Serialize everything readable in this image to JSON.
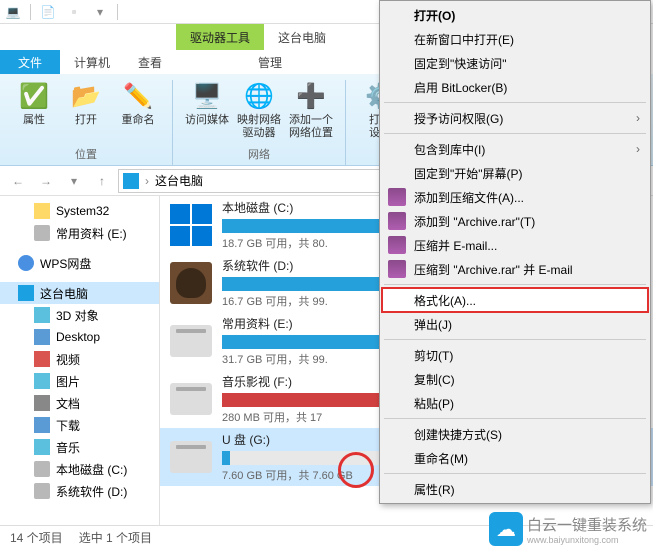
{
  "titlebar": {
    "drive_tools": "驱动器工具",
    "this_pc": "这台电脑"
  },
  "menu": {
    "file": "文件",
    "computer": "计算机",
    "view": "查看",
    "manage": "管理"
  },
  "ribbon": {
    "properties": "属性",
    "open": "打开",
    "rename": "重命名",
    "media": "访问媒体",
    "network": "映射网络\n驱动器",
    "netloc": "添加一个\n网络位置",
    "settings": "打开\n设置",
    "group_location": "位置",
    "group_network": "网络"
  },
  "address": {
    "path": "这台电脑"
  },
  "tree": {
    "system32": "System32",
    "common": "常用资料 (E:)",
    "wps": "WPS网盘",
    "thispc": "这台电脑",
    "obj3d": "3D 对象",
    "desktop": "Desktop",
    "video": "视频",
    "pictures": "图片",
    "docs": "文档",
    "downloads": "下载",
    "music": "音乐",
    "localc": "本地磁盘 (C:)",
    "sysd": "系统软件 (D:)"
  },
  "drives": [
    {
      "name": "本地磁盘 (C:)",
      "free": "18.7 GB 可用，共 80.",
      "pct": 76,
      "red": false,
      "icon": "win"
    },
    {
      "name": "系统软件 (D:)",
      "free": "16.7 GB 可用，共 99.",
      "pct": 82,
      "red": false,
      "icon": "avatar"
    },
    {
      "name": "常用资料 (E:)",
      "free": "31.7 GB 可用，共 99.",
      "pct": 66,
      "red": false,
      "icon": "drive"
    },
    {
      "name": "音乐影视 (F:)",
      "free": "280 MB 可用，共 17",
      "pct": 98,
      "red": true,
      "icon": "drive"
    },
    {
      "name": "U 盘 (G:)",
      "free": "7.60 GB 可用，共 7.60 GB",
      "pct": 2,
      "red": false,
      "icon": "drive",
      "sel": true
    }
  ],
  "ctx": {
    "open": "打开(O)",
    "newwin": "在新窗口中打开(E)",
    "pinquick": "固定到\"快速访问\"",
    "bitlocker": "启用 BitLocker(B)",
    "access": "授予访问权限(G)",
    "library": "包含到库中(I)",
    "pinstart": "固定到\"开始\"屏幕(P)",
    "addarc": "添加到压缩文件(A)...",
    "addrar": "添加到 \"Archive.rar\"(T)",
    "email": "压缩并 E-mail...",
    "emailrar": "压缩到 \"Archive.rar\" 并 E-mail",
    "format": "格式化(A)...",
    "eject": "弹出(J)",
    "cut": "剪切(T)",
    "copy": "复制(C)",
    "paste": "粘贴(P)",
    "shortcut": "创建快捷方式(S)",
    "rename": "重命名(M)",
    "props": "属性(R)"
  },
  "status": {
    "items": "14 个项目",
    "selected": "选中 1 个项目"
  },
  "watermark": {
    "brand": "白云一键重装系统",
    "url": "www.baiyunxitong.com"
  }
}
